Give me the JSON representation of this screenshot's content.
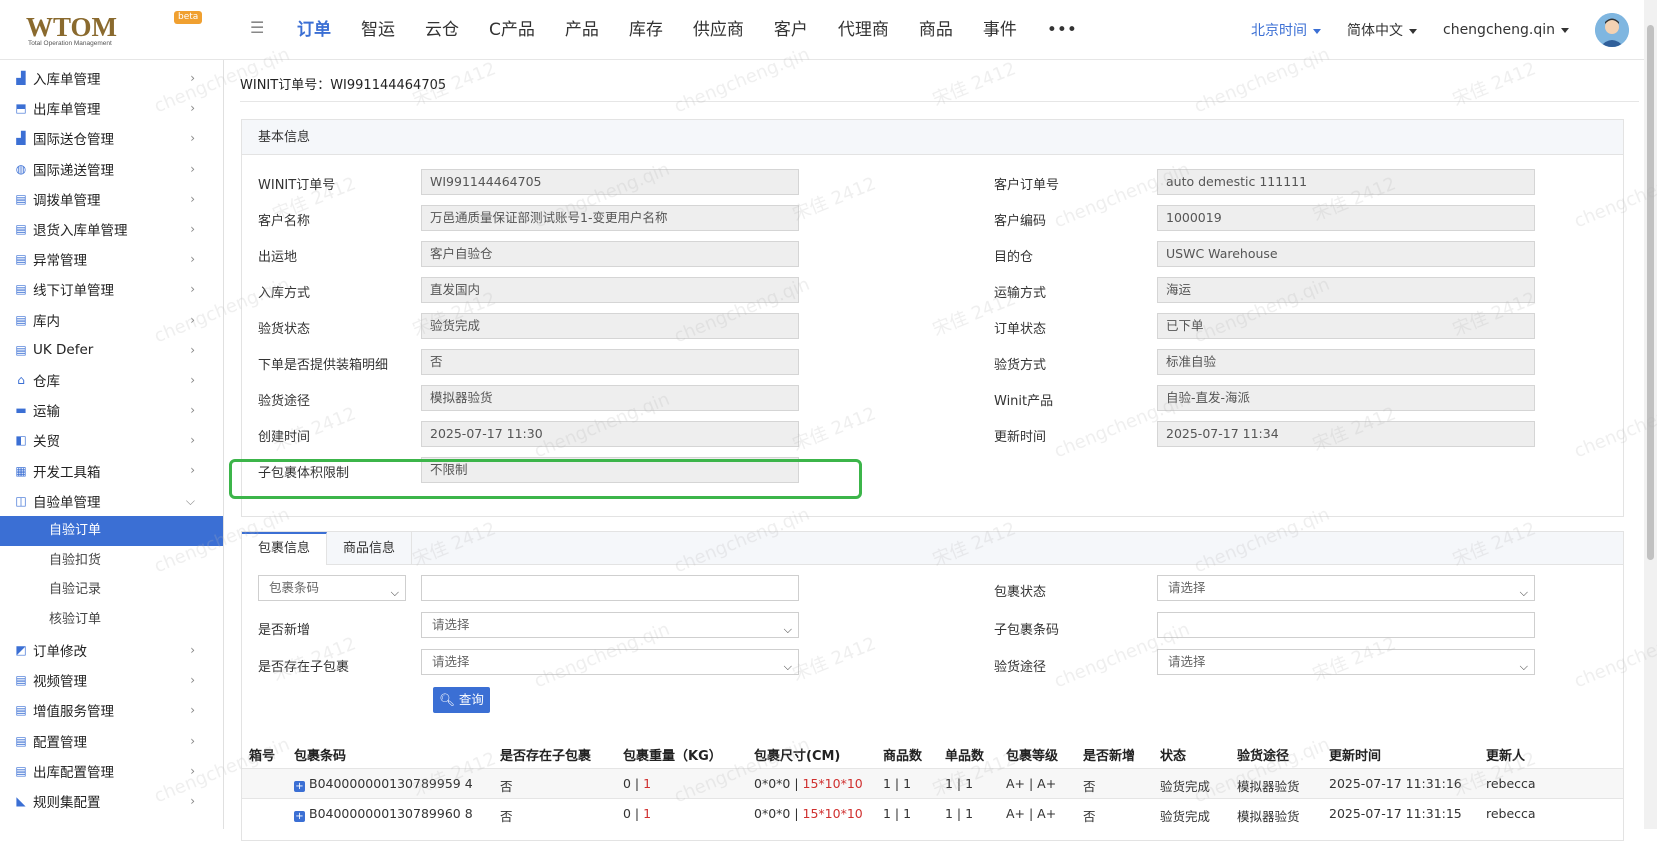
{
  "header": {
    "logo_text": "WTOM",
    "logo_tagline": "Total Operation Management",
    "logo_badge": "beta",
    "nav": [
      "订单",
      "智运",
      "云仓",
      "C产品",
      "产品",
      "库存",
      "供应商",
      "客户",
      "代理商",
      "商品",
      "事件",
      "•••"
    ],
    "active_nav": "订单",
    "timezone": "北京时间",
    "language": "简体中文",
    "user": "chengcheng.qin"
  },
  "sidebar": {
    "items": [
      {
        "label": "入库单管理",
        "icon": "building-icon"
      },
      {
        "label": "出库单管理",
        "icon": "truck-out-icon"
      },
      {
        "label": "国际送仓管理",
        "icon": "building-icon"
      },
      {
        "label": "国际递送管理",
        "icon": "globe-icon"
      },
      {
        "label": "调拨单管理",
        "icon": "document-icon"
      },
      {
        "label": "退货入库单管理",
        "icon": "document-icon"
      },
      {
        "label": "异常管理",
        "icon": "document-icon"
      },
      {
        "label": "线下订单管理",
        "icon": "list-icon"
      },
      {
        "label": "库内",
        "icon": "document-icon"
      },
      {
        "label": "UK Defer",
        "icon": "document-icon"
      },
      {
        "label": "仓库",
        "icon": "warehouse-icon"
      },
      {
        "label": "运输",
        "icon": "truck-icon"
      },
      {
        "label": "关贸",
        "icon": "customs-icon"
      },
      {
        "label": "开发工具箱",
        "icon": "grid-icon"
      },
      {
        "label": "自验单管理",
        "icon": "inspect-icon",
        "expanded": true
      }
    ],
    "subitems": [
      "自验订单",
      "自验扣货",
      "自验记录",
      "核验订单"
    ],
    "active_sub": "自验订单",
    "items_after": [
      {
        "label": "订单修改",
        "icon": "edit-icon"
      },
      {
        "label": "视频管理",
        "icon": "list-icon"
      },
      {
        "label": "增值服务管理",
        "icon": "list-icon"
      },
      {
        "label": "配置管理",
        "icon": "list-icon"
      },
      {
        "label": "出库配置管理",
        "icon": "list-icon"
      },
      {
        "label": "规则集配置",
        "icon": "chart-icon"
      }
    ]
  },
  "page": {
    "order_title": "WINIT订单号：WI991144464705",
    "basic_info_title": "基本信息"
  },
  "basic_info": {
    "left": [
      {
        "label": "WINIT订单号",
        "value": "WI991144464705"
      },
      {
        "label": "客户名称",
        "value": "万邑通质量保证部测试账号1-变更用户名称"
      },
      {
        "label": "出运地",
        "value": "客户自验仓"
      },
      {
        "label": "入库方式",
        "value": "直发国内"
      },
      {
        "label": "验货状态",
        "value": "验货完成"
      },
      {
        "label": "下单是否提供装箱明细",
        "value": "否"
      },
      {
        "label": "验货途径",
        "value": "模拟器验货"
      },
      {
        "label": "创建时间",
        "value": "2025-07-17 11:30"
      },
      {
        "label": "子包裹体积限制",
        "value": "不限制"
      }
    ],
    "right": [
      {
        "label": "客户订单号",
        "value": "auto demestic 111111"
      },
      {
        "label": "客户编码",
        "value": "1000019"
      },
      {
        "label": "目的仓",
        "value": "USWC Warehouse"
      },
      {
        "label": "运输方式",
        "value": "海运"
      },
      {
        "label": "订单状态",
        "value": "已下单"
      },
      {
        "label": "验货方式",
        "value": "标准自验"
      },
      {
        "label": "Winit产品",
        "value": "自验-直发-海派"
      },
      {
        "label": "更新时间",
        "value": "2025-07-17 11:34"
      }
    ]
  },
  "package_tabs": [
    "包裹信息",
    "商品信息"
  ],
  "filters": {
    "barcode_type": "包裹条码",
    "barcode_value": "",
    "package_status_label": "包裹状态",
    "package_status_value": "请选择",
    "is_new_label": "是否新增",
    "is_new_value": "请选择",
    "sub_barcode_label": "子包裹条码",
    "sub_barcode_value": "",
    "has_sub_label": "是否存在子包裹",
    "has_sub_value": "请选择",
    "inspect_route_label": "验货途径",
    "inspect_route_value": "请选择",
    "query_button": "查询"
  },
  "table": {
    "headers": [
      "箱号",
      "包裹条码",
      "是否存在子包裹",
      "包裹重量（KG）",
      "包裹尺寸(CM)",
      "商品数",
      "单品数",
      "包裹等级",
      "是否新增",
      "状态",
      "验货途径",
      "更新时间",
      "更新人"
    ],
    "rows": [
      {
        "box": "",
        "barcode": "B040000000130789959 4",
        "has_sub": "否",
        "weight_a": "0 | ",
        "weight_b": "1",
        "size_a": "0*0*0 | ",
        "size_b": "15*10*10",
        "items": "1 | 1",
        "units": "1 | 1",
        "grade": "A+ | A+",
        "is_new": "否",
        "status": "验货完成",
        "route": "模拟器验货",
        "updated": "2025-07-17 11:31:16",
        "updater": "rebecca"
      },
      {
        "box": "",
        "barcode": "B040000000130789960 8",
        "has_sub": "否",
        "weight_a": "0 | ",
        "weight_b": "1",
        "size_a": "0*0*0 | ",
        "size_b": "15*10*10",
        "items": "1 | 1",
        "units": "1 | 1",
        "grade": "A+ | A+",
        "is_new": "否",
        "status": "验货完成",
        "route": "模拟器验货",
        "updated": "2025-07-17 11:31:15",
        "updater": "rebecca"
      }
    ]
  },
  "watermarks": [
    "chengcheng.qin",
    "宋佳 2412"
  ],
  "colors": {
    "accent": "#3b6fd4",
    "highlight": "#3cb54a",
    "red": "#d0302f"
  }
}
